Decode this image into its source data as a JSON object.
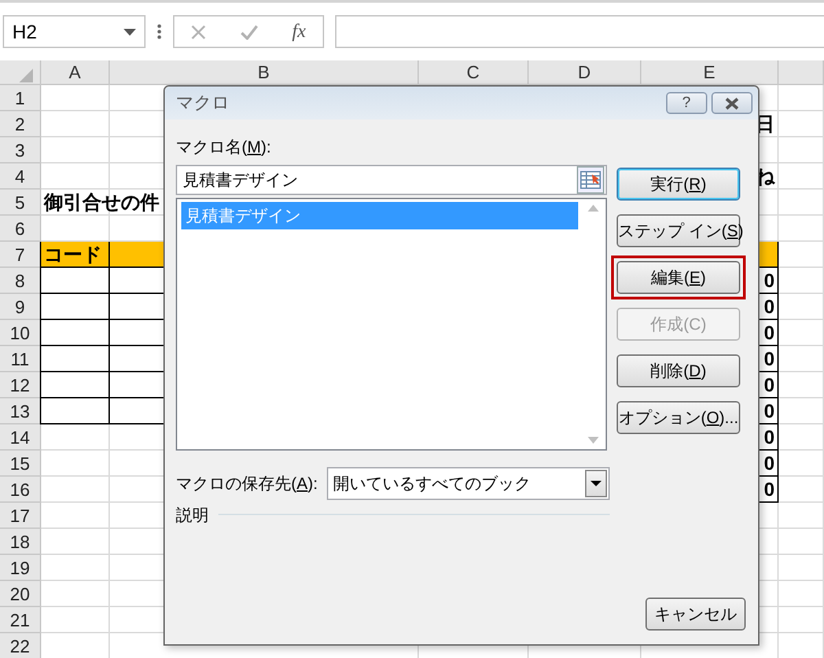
{
  "name_box": {
    "value": "H2"
  },
  "formula_bar": {
    "function_label": "fx"
  },
  "columns": [
    "A",
    "B",
    "C",
    "D",
    "E"
  ],
  "rows": [
    {
      "header": "1",
      "highlighted": false,
      "left_boxed": false,
      "right_boxed": false
    },
    {
      "header": "2",
      "highlighted": false,
      "left_boxed": false,
      "right_boxed": false,
      "column_e": "日"
    },
    {
      "header": "3",
      "highlighted": false,
      "left_boxed": false,
      "right_boxed": false
    },
    {
      "header": "4",
      "highlighted": false,
      "left_boxed": false,
      "right_boxed": false,
      "column_e": "ね"
    },
    {
      "header": "5",
      "highlighted": false,
      "left_boxed": false,
      "right_boxed": false,
      "column_a": "御引合せの件"
    },
    {
      "header": "6",
      "highlighted": false,
      "left_boxed": false,
      "right_boxed": false
    },
    {
      "header": "7",
      "highlighted": true,
      "left_boxed": true,
      "right_boxed": true,
      "column_a": "コード"
    },
    {
      "header": "8",
      "highlighted": false,
      "left_boxed": true,
      "right_boxed": true,
      "column_e": "0"
    },
    {
      "header": "9",
      "highlighted": false,
      "left_boxed": true,
      "right_boxed": true,
      "column_e": "0"
    },
    {
      "header": "10",
      "highlighted": false,
      "left_boxed": true,
      "right_boxed": true,
      "column_e": "0"
    },
    {
      "header": "11",
      "highlighted": false,
      "left_boxed": true,
      "right_boxed": true,
      "column_e": "0"
    },
    {
      "header": "12",
      "highlighted": false,
      "left_boxed": true,
      "right_boxed": true,
      "column_e": "0"
    },
    {
      "header": "13",
      "highlighted": false,
      "left_boxed": true,
      "right_boxed": true,
      "column_e": "0"
    },
    {
      "header": "14",
      "highlighted": false,
      "left_boxed": false,
      "right_boxed": true,
      "column_e": "0"
    },
    {
      "header": "15",
      "highlighted": false,
      "left_boxed": false,
      "right_boxed": true,
      "column_e": "0"
    },
    {
      "header": "16",
      "highlighted": false,
      "left_boxed": false,
      "right_boxed": true,
      "column_e": "0"
    },
    {
      "header": "17",
      "highlighted": false,
      "left_boxed": false,
      "right_boxed": false
    },
    {
      "header": "18",
      "highlighted": false,
      "left_boxed": false,
      "right_boxed": false
    },
    {
      "header": "19",
      "highlighted": false,
      "left_boxed": false,
      "right_boxed": false
    },
    {
      "header": "20",
      "highlighted": false,
      "left_boxed": false,
      "right_boxed": false
    },
    {
      "header": "21",
      "highlighted": false,
      "left_boxed": false,
      "right_boxed": false
    },
    {
      "header": "22",
      "highlighted": false,
      "left_boxed": false,
      "right_boxed": false
    }
  ],
  "dialog": {
    "title": "マクロ",
    "help_button": "?",
    "name_label": {
      "before": "マクロ名(",
      "key": "M",
      "after": "):"
    },
    "name_value": "見積書デザイン",
    "macros": [
      {
        "label": "見積書デザイン",
        "selected": true
      }
    ],
    "buttons": [
      {
        "before": "実行(",
        "key": "R",
        "after": ")",
        "default": true,
        "disabled": false,
        "highlighted": false
      },
      {
        "before": "ステップ イン(",
        "key": "S",
        "after": ")",
        "default": false,
        "disabled": false,
        "highlighted": false
      },
      {
        "before": "編集(",
        "key": "E",
        "after": ")",
        "default": false,
        "disabled": false,
        "highlighted": true
      },
      {
        "before": "作成(C)",
        "default": false,
        "disabled": true,
        "highlighted": false
      },
      {
        "before": "削除(",
        "key": "D",
        "after": ")",
        "default": false,
        "disabled": false,
        "highlighted": false
      },
      {
        "before": "オプション(",
        "key": "O",
        "after": ")...",
        "default": false,
        "disabled": false,
        "highlighted": false
      }
    ],
    "location_label": {
      "before": "マクロの保存先(",
      "key": "A",
      "after": "):"
    },
    "location_value": "開いているすべてのブック",
    "description_label": "説明",
    "cancel_button": "キャンセル"
  }
}
